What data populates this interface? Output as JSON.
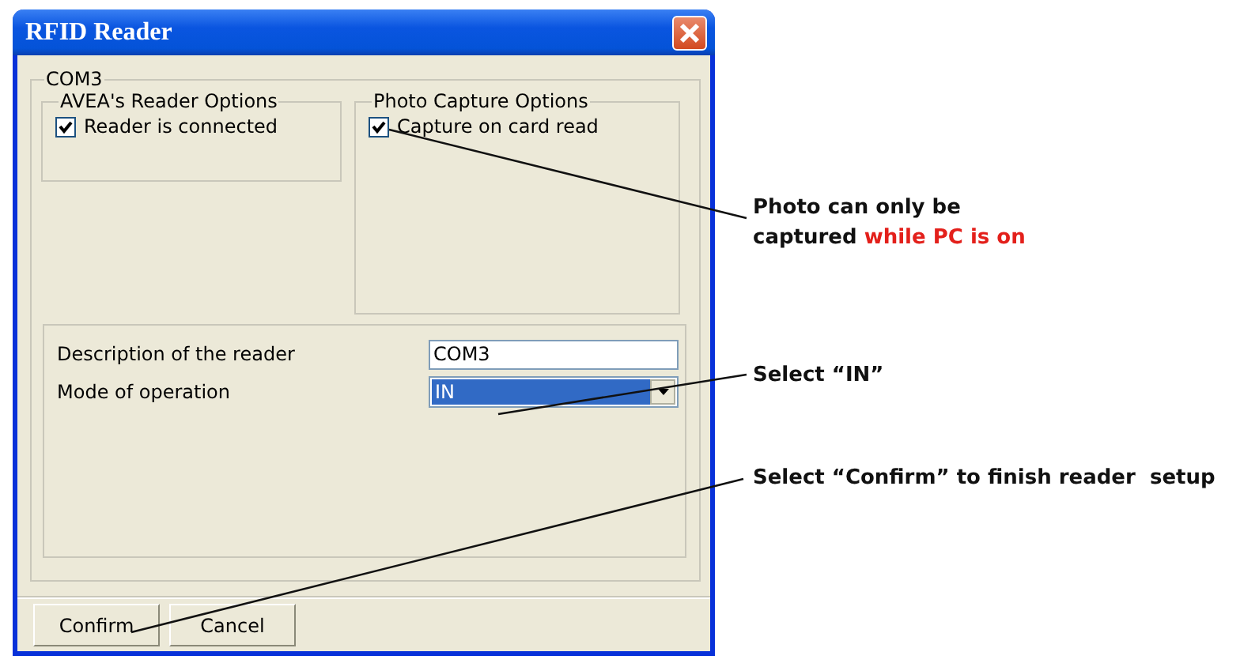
{
  "window": {
    "title": "RFID Reader"
  },
  "port_group": {
    "legend": "COM3"
  },
  "reader_options": {
    "legend": "AVEA's Reader Options",
    "checkbox": {
      "label": "Reader is connected",
      "checked": true
    }
  },
  "photo_options": {
    "legend": "Photo Capture Options",
    "checkbox": {
      "label": "Capture on card read",
      "checked": true
    }
  },
  "fields": [
    {
      "kind": "text",
      "label": "Description of the reader",
      "value": "COM3"
    },
    {
      "kind": "dropdown",
      "label": "Mode of operation",
      "value": "IN",
      "highlighted": true
    }
  ],
  "buttons": [
    "Confirm",
    "Cancel"
  ],
  "annotations": [
    {
      "lines": [
        [
          {
            "text": "Photo can only be",
            "highlight": false
          }
        ],
        [
          {
            "text": "captured ",
            "highlight": false
          },
          {
            "text": "while PC is on",
            "highlight": true
          }
        ]
      ]
    },
    {
      "lines": [
        [
          {
            "text": "Select “IN”",
            "highlight": false
          }
        ]
      ]
    },
    {
      "lines": [
        [
          {
            "text": "Select “Confirm” to finish reader  setup",
            "highlight": false
          }
        ]
      ]
    }
  ]
}
